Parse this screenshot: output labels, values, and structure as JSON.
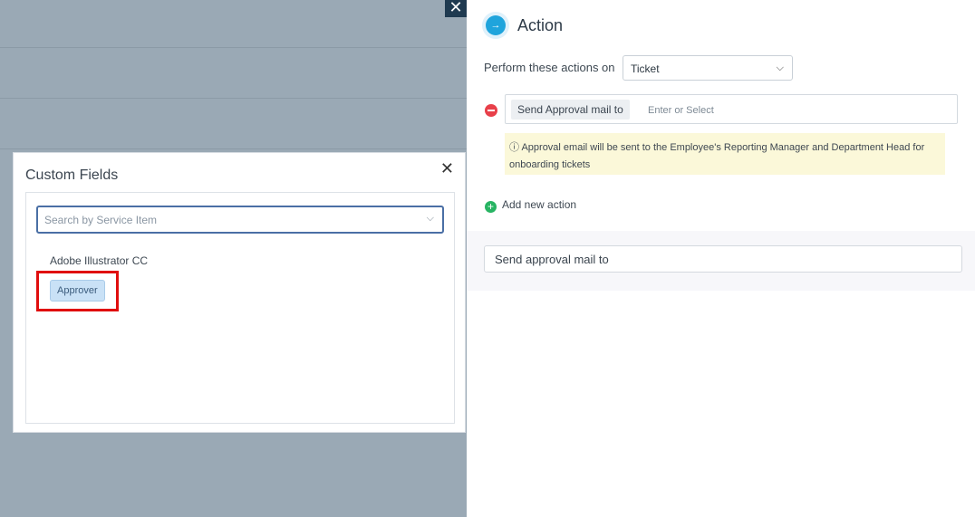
{
  "overlay": {
    "close_label": "✕"
  },
  "custom_fields": {
    "title": "Custom Fields",
    "close_label": "✕",
    "search_placeholder": "Search by Service Item",
    "group_label": "Adobe Illustrator CC",
    "chip_label": "Approver"
  },
  "action": {
    "title": "Action",
    "perform_label": "Perform these actions on",
    "select_value": "Ticket",
    "action_chip": "Send Approval mail to",
    "action_placeholder": "Enter or Select",
    "info_text": "Approval email will be sent to the Employee's Reporting Manager and Department Head for onboarding tickets",
    "add_label": "Add new action",
    "approval_value": "Send approval mail to"
  },
  "colors": {
    "overlay": "#9aa9b5",
    "highlight_border": "#e00d0d",
    "accent": "#1fa4dc",
    "remove": "#e8404a",
    "add": "#28b463"
  }
}
